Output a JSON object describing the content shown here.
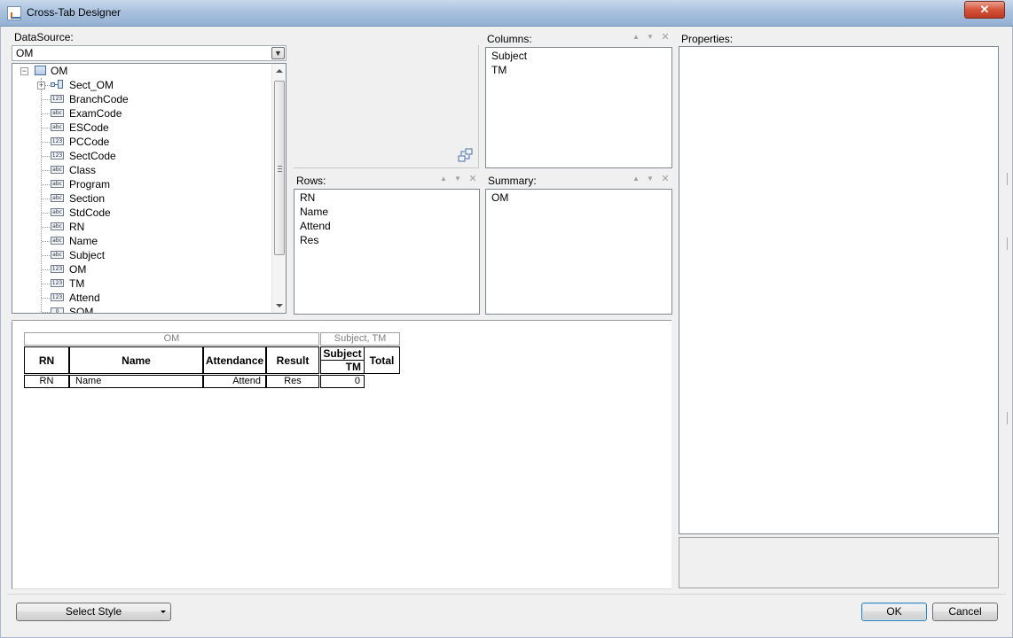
{
  "window": {
    "title": "Cross-Tab Designer",
    "close_glyph": "✕"
  },
  "datasource": {
    "label": "DataSource:",
    "value": "OM",
    "tree": {
      "root": "OM",
      "items": [
        {
          "label": "Sect_OM",
          "icon": "relation-icon",
          "expandable": true
        },
        {
          "label": "BranchCode",
          "icon": "numeric-field-icon",
          "type": "123"
        },
        {
          "label": "ExamCode",
          "icon": "text-field-icon",
          "type": "abc"
        },
        {
          "label": "ESCode",
          "icon": "text-field-icon",
          "type": "abc"
        },
        {
          "label": "PCCode",
          "icon": "numeric-field-icon",
          "type": "123"
        },
        {
          "label": "SectCode",
          "icon": "numeric-field-icon",
          "type": "123"
        },
        {
          "label": "Class",
          "icon": "text-field-icon",
          "type": "abc"
        },
        {
          "label": "Program",
          "icon": "text-field-icon",
          "type": "abc"
        },
        {
          "label": "Section",
          "icon": "text-field-icon",
          "type": "abc"
        },
        {
          "label": "StdCode",
          "icon": "text-field-icon",
          "type": "abc"
        },
        {
          "label": "RN",
          "icon": "text-field-icon",
          "type": "abc"
        },
        {
          "label": "Name",
          "icon": "text-field-icon",
          "type": "abc"
        },
        {
          "label": "Subject",
          "icon": "text-field-icon",
          "type": "abc"
        },
        {
          "label": "OM",
          "icon": "numeric-field-icon",
          "type": "123"
        },
        {
          "label": "TM",
          "icon": "numeric-field-icon",
          "type": "123"
        },
        {
          "label": "Attend",
          "icon": "numeric-field-icon",
          "type": "123"
        },
        {
          "label": "SOM",
          "icon": "numeric-field-icon",
          "type": "0"
        }
      ]
    }
  },
  "columns": {
    "label": "Columns:",
    "items": [
      "Subject",
      "TM"
    ]
  },
  "rows": {
    "label": "Rows:",
    "items": [
      "RN",
      "Name",
      "Attend",
      "Res"
    ]
  },
  "summary": {
    "label": "Summary:",
    "items": [
      "OM"
    ]
  },
  "properties": {
    "label": "Properties:"
  },
  "preview": {
    "summary_caption": "OM",
    "column_caption": "Subject, TM",
    "headers": [
      "RN",
      "Name",
      "Attendance",
      "Result"
    ],
    "col_header_top": "Subject",
    "col_header_bottom": "TM",
    "total_header": "Total",
    "row": [
      "RN",
      "Name",
      "Attend",
      "Res"
    ],
    "row_value": "0"
  },
  "footer": {
    "select_style": "Select Style",
    "ok": "OK",
    "cancel": "Cancel"
  },
  "colors": {
    "titlebar": "#a9c1de",
    "close": "#c03a22",
    "default_button": "#3c7fb1"
  }
}
